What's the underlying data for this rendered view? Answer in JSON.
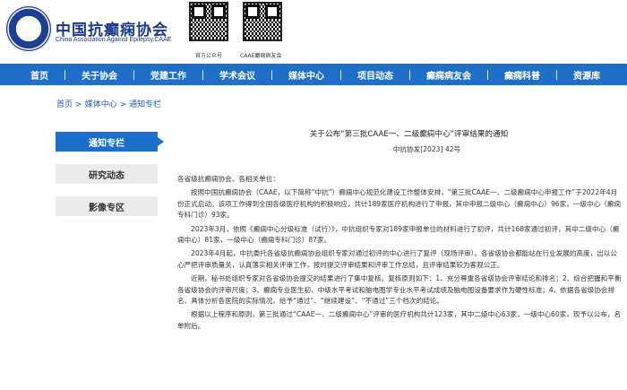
{
  "header": {
    "org_name_cn": "中国抗癫痫协会",
    "org_name_en": "China Association Against Epilepsy.CAAE",
    "qr_official_caption": "官方公众号",
    "qr_patient_caption": "CAAE癫痫病友会"
  },
  "nav": {
    "items": [
      "首页",
      "关于协会",
      "党建工作",
      "学术会议",
      "媒体中心",
      "项目动态",
      "癫痫病友会",
      "癫痫科普",
      "资源库"
    ]
  },
  "breadcrumb": {
    "home": "首页",
    "media": "媒体中心",
    "notices": "通知专栏",
    "separator": ">"
  },
  "sidebar": {
    "items": [
      {
        "label": "通知专栏",
        "active": true
      },
      {
        "label": "研究动态",
        "active": false
      },
      {
        "label": "影像专区",
        "active": false
      }
    ]
  },
  "article": {
    "title": "关于公布“第三批CAAE一、二级癫痫中心”评审结果的通知",
    "doc_number": "中抗协发[2023] 42号",
    "salutation": "各省级抗癫痫协会、各相关单位：",
    "paragraphs": [
      "按照中国抗癫痫协会（CAAE，以下简称“中抗”）癫痫中心规范化建设工作整体安排，“第三批CAAE一、二级癫痫中心申报工作”于2022年4月份正式启动。该项工作得到全国各级医疗机构的积极响应，共计189家医疗机构进行了申报，其中申报二级中心（癫痫中心）96家，一级中心（癫痫专科门诊）93家。",
      "2023年3月，依照《癫痫中心分级标准（试行）》，中抗组织专家对189家申报单位的材料进行了初评，共计168家通过初评，其中二级中心（癫痫中心）81家，一级中心（癫痫专科门诊）87家。",
      "2023年4月起，中抗委托各省级抗癫痫协会组织专家对通过初评的中心进行了复评（现场评审）。各省级协会都能站在行业发展的高度，出以公心严把评审质量关，认真落实相关评审工作，按时提交评审结果和评审工作总结，且评审结果较为客观公正。",
      "近期，秘书处组织专家对各省级协会提交的结果进行了集中复核。复核原则如下：1、充分尊重各省级协会评审结论和排名；2、综合把握和平衡各省级协会的评审尺度；3、癫痫专业医生初、中级水平考试和脑电图学专业水平考试成绩及脑电图设备要求作为硬性标准；4、依据各省级协会排名、具体分析各医院的实际情况，给予“通过”、“继续建设”、“不通过”三个档次的结论。",
      "根据以上程序和原则，第三批通过“CAAE一、二级癫痫中心”评审的医疗机构共计123家，其中二级中心63家，一级中心60家，现予以公布，名单附后。"
    ]
  },
  "colors": {
    "nav_bg": "#1d6fc9",
    "brand_blue": "#1a3a8a",
    "link_blue": "#1d5fb6",
    "sidebar_inactive_bg": "#ebebeb"
  }
}
